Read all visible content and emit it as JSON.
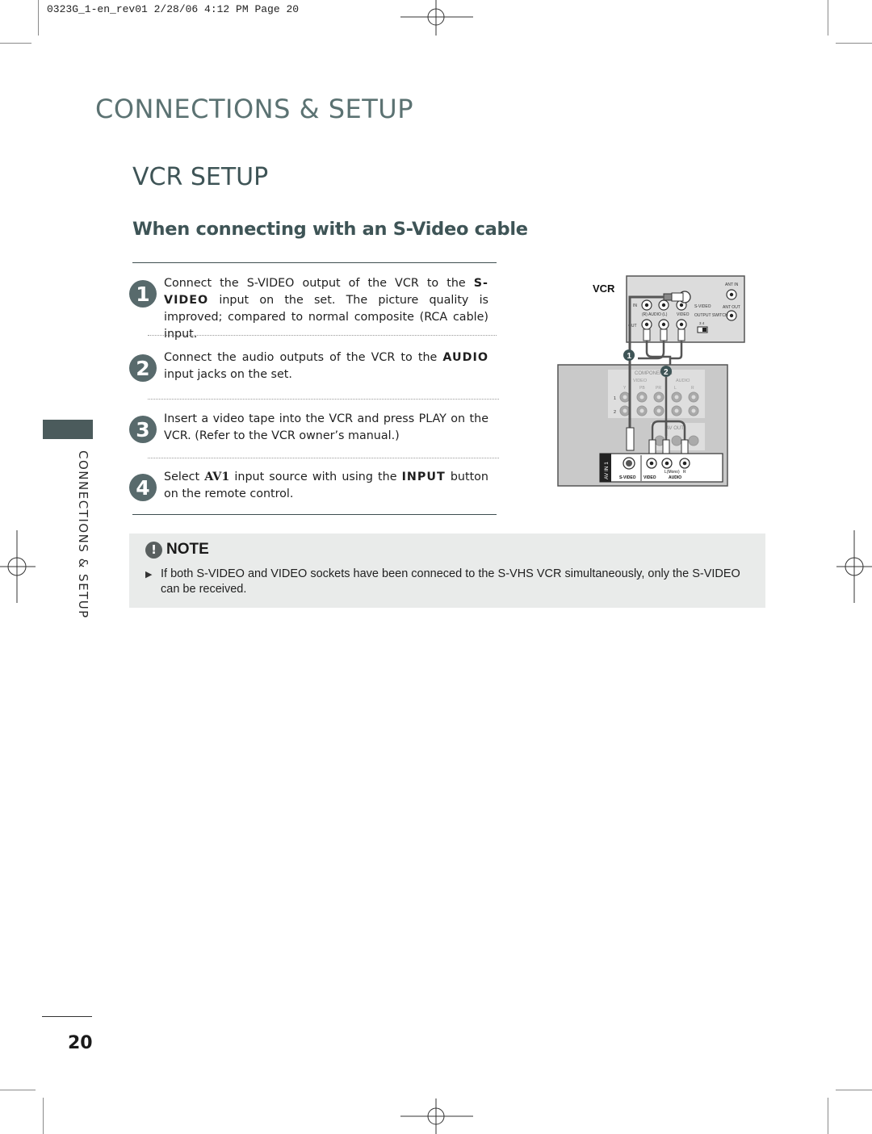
{
  "print_header": {
    "slug": "0323G_1-en_rev01  2/28/06  4:12 PM  Page 20"
  },
  "chapter_title": "CONNECTIONS & SETUP",
  "section_title": "VCR SETUP",
  "subsection_title": "When connecting with an S-Video cable",
  "side_tab_label": "CONNECTIONS & SETUP",
  "steps": [
    {
      "number": "1",
      "text_before": "Connect the S-VIDEO output of the VCR to the ",
      "bold": "S-VIDEO",
      "text_after": " input on the set. The picture quality is improved; compared to normal composite (RCA cable) input."
    },
    {
      "number": "2",
      "text_before": "Connect the audio outputs of the VCR to the ",
      "bold": "AUDIO",
      "text_after": " input jacks on the set."
    },
    {
      "number": "3",
      "text_before": "Insert a video tape into the VCR and press PLAY on the VCR. (Refer to the VCR owner’s manual.)",
      "bold": "",
      "text_after": ""
    },
    {
      "number": "4",
      "text_before": "Select ",
      "bold": "AV1",
      "text_middle": " input source with using the ",
      "bold2": "INPUT",
      "text_after": " button on the remote control."
    }
  ],
  "diagram": {
    "vcr_label": "VCR",
    "vcr_panel": {
      "ant_in": "ANT IN",
      "ant_out": "ANT OUT",
      "in": "IN",
      "out": "OUT",
      "audio": "(R) AUDIO (L)",
      "video": "VIDEO",
      "s_video": "S-VIDEO",
      "output_switch": "OUTPUT SWITCH",
      "switch_values": "3  4"
    },
    "markers": [
      "1",
      "2"
    ],
    "tv_panel": {
      "component_in": "COMPONENT IN",
      "video": "VIDEO",
      "audio": "AUDIO",
      "cols": [
        "Y",
        "PB",
        "PR",
        "L",
        "R"
      ],
      "rows": [
        "1",
        "2"
      ],
      "av_out": "AV OUT",
      "av_in": "AV IN 1",
      "s_video": "S-VIDEO",
      "video_jack": "VIDEO",
      "l_mono": "L(Mono)",
      "r": "R",
      "audio_label": "AUDIO"
    }
  },
  "note": {
    "title": "NOTE",
    "icon": "exclamation-icon",
    "bullet_icon": "triangle-right-icon",
    "text": "If both S-VIDEO and VIDEO sockets have been conneced to the S-VHS VCR simultaneously, only the S-VIDEO can be received."
  },
  "page_number": "20"
}
